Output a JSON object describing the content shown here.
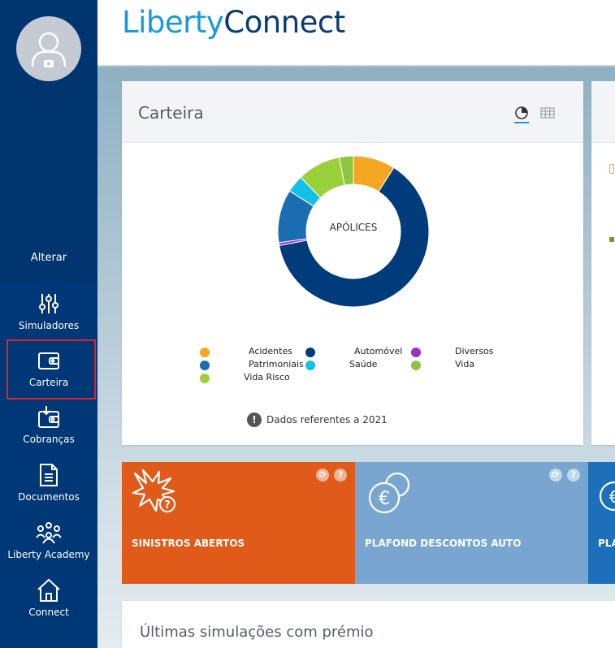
{
  "brand": {
    "part1": "Liberty",
    "part2": "Connect"
  },
  "sidebar": {
    "change_label": "Alterar",
    "items": [
      {
        "label": "Simuladores",
        "icon": "sliders-icon"
      },
      {
        "label": "Carteira",
        "icon": "wallet-icon",
        "selected": true
      },
      {
        "label": "Cobranças",
        "icon": "payments-icon"
      },
      {
        "label": "Documentos",
        "icon": "document-icon"
      },
      {
        "label": "Liberty Academy",
        "icon": "people-icon"
      },
      {
        "label": "Connect",
        "icon": "home-icon"
      }
    ]
  },
  "carteira": {
    "title": "Carteira",
    "chart_center_label": "APÓLICES",
    "note": "Dados referentes a 2021"
  },
  "chart_data": {
    "type": "pie",
    "categories": [
      "Acidentes",
      "Automóvel",
      "Diversos",
      "Patrimoniais",
      "Saúde",
      "Vida",
      "Vida Risco"
    ],
    "values": [
      9,
      63,
      0.6,
      11.4,
      3.7,
      3,
      9.3
    ],
    "colors": [
      "#f5a623",
      "#003b7c",
      "#9b30c8",
      "#1a6db0",
      "#13c0e6",
      "#8cc63f",
      "#9ad13a"
    ],
    "legend_placement": "bottom"
  },
  "tiles": [
    {
      "label": "SINISTROS ABERTOS",
      "color": "#e05a1a"
    },
    {
      "label": "PLAFOND DESCONTOS AUTO",
      "color": "#78a6d0"
    },
    {
      "label": "PLA",
      "color": "#1c6fb8"
    }
  ],
  "tile_help": "?",
  "bottom_section": {
    "title": "Últimas simulações com prémio"
  },
  "colors": {
    "sidebar": "#003776",
    "accent": "#1a9ad6",
    "brand_dark": "#0a3a73"
  }
}
